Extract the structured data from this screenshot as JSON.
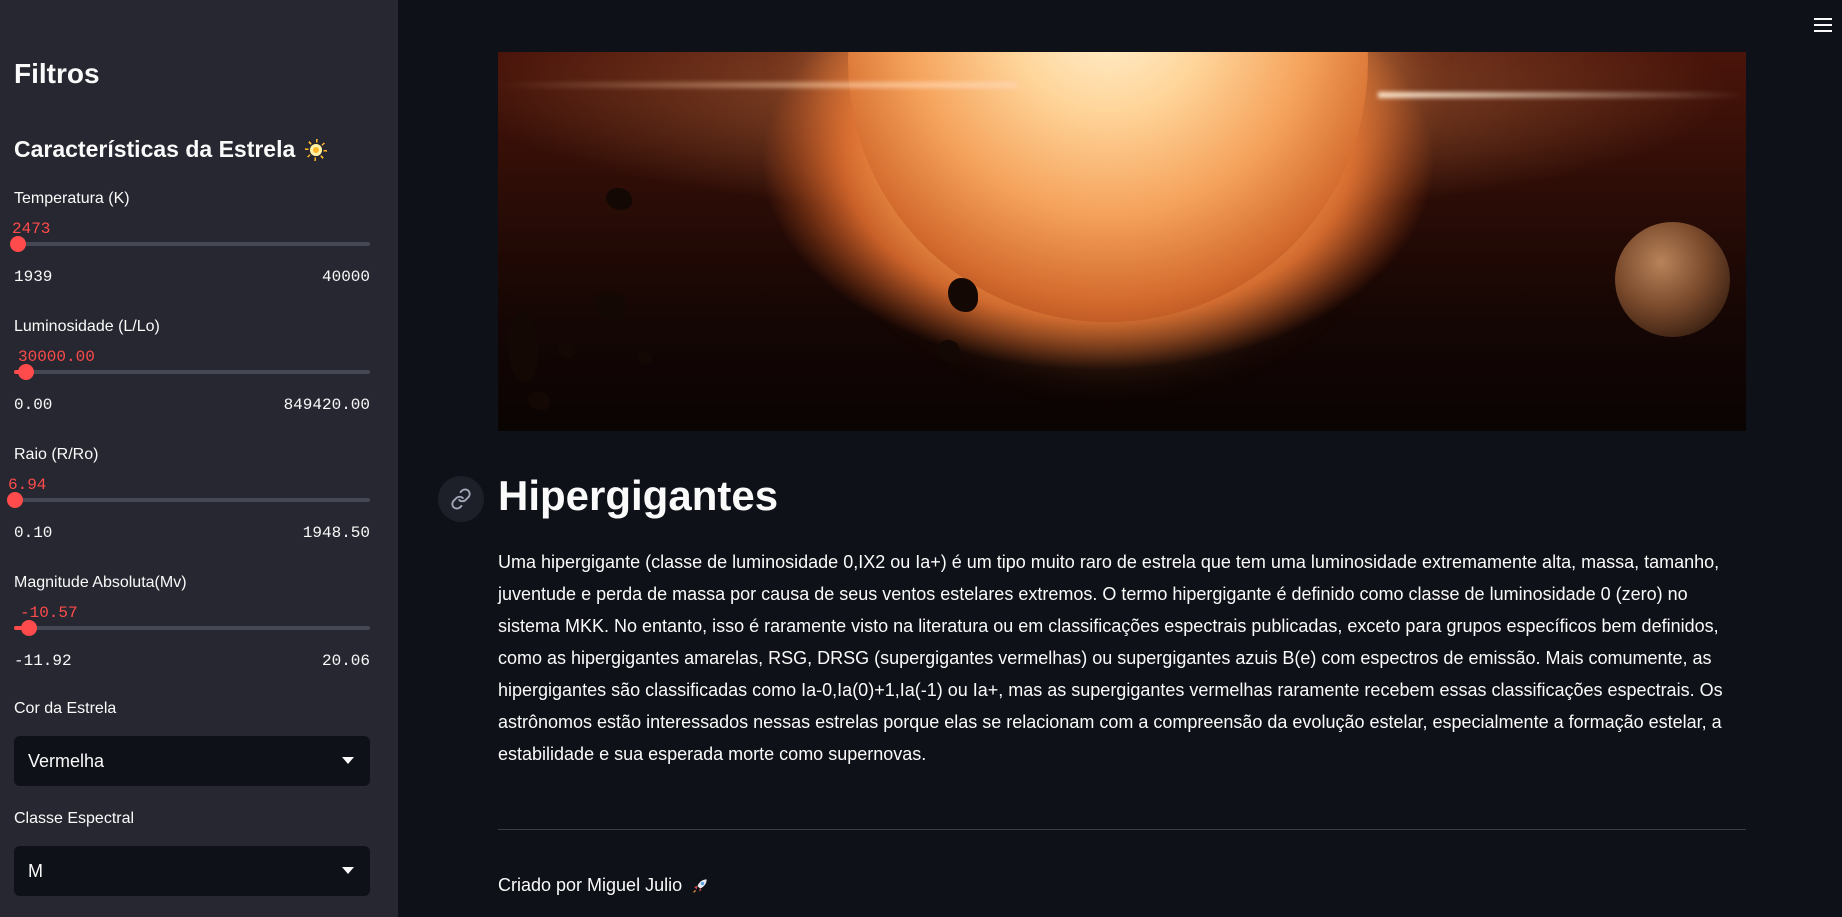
{
  "sidebar": {
    "title": "Filtros",
    "section_title": "Características da Estrela",
    "section_icon": "sun-icon",
    "sliders": [
      {
        "label": "Temperatura (K)",
        "value": "2473",
        "min": "1939",
        "max": "40000"
      },
      {
        "label": "Luminosidade (L/Lo)",
        "value": "30000.00",
        "min": "0.00",
        "max": "849420.00"
      },
      {
        "label": "Raio (R/Ro)",
        "value": "6.94",
        "min": "0.10",
        "max": "1948.50"
      },
      {
        "label": "Magnitude Absoluta(Mv)",
        "value": "-10.57",
        "min": "-11.92",
        "max": "20.06"
      }
    ],
    "selects": [
      {
        "label": "Cor da Estrela",
        "value": "Vermelha"
      },
      {
        "label": "Classe Espectral",
        "value": "M"
      }
    ]
  },
  "main": {
    "title": "Hipergigantes",
    "description": "Uma hipergigante (classe de luminosidade 0,IX2 ou Ia+) é um tipo muito raro de estrela que tem uma luminosidade extremamente alta, massa, tamanho, juventude e perda de massa por causa de seus ventos estelares extremos. O termo hipergigante é definido como classe de luminosidade 0 (zero) no sistema MKK. No entanto, isso é raramente visto na literatura ou em classificações espectrais publicadas, exceto para grupos específicos bem definidos, como as hipergigantes amarelas, RSG, DRSG (supergigantes vermelhas) ou supergigantes azuis B(e) com espectros de emissão. Mais comumente, as hipergigantes são classificadas como Ia-0,Ia(0)+1,Ia(-1) ou Ia+, mas as supergigantes vermelhas raramente recebem essas classificações espectrais. Os astrônomos estão interessados nessas estrelas porque elas se relacionam com a compreensão da evolução estelar, especialmente a formação estelar, a estabilidade e sua esperada morte como supernovas.",
    "credits": "Criado por Miguel Julio",
    "credits_icon": "rocket-icon"
  },
  "colors": {
    "accent": "#ff4b4b",
    "sidebar_bg": "#262730",
    "main_bg": "#0e1117"
  }
}
